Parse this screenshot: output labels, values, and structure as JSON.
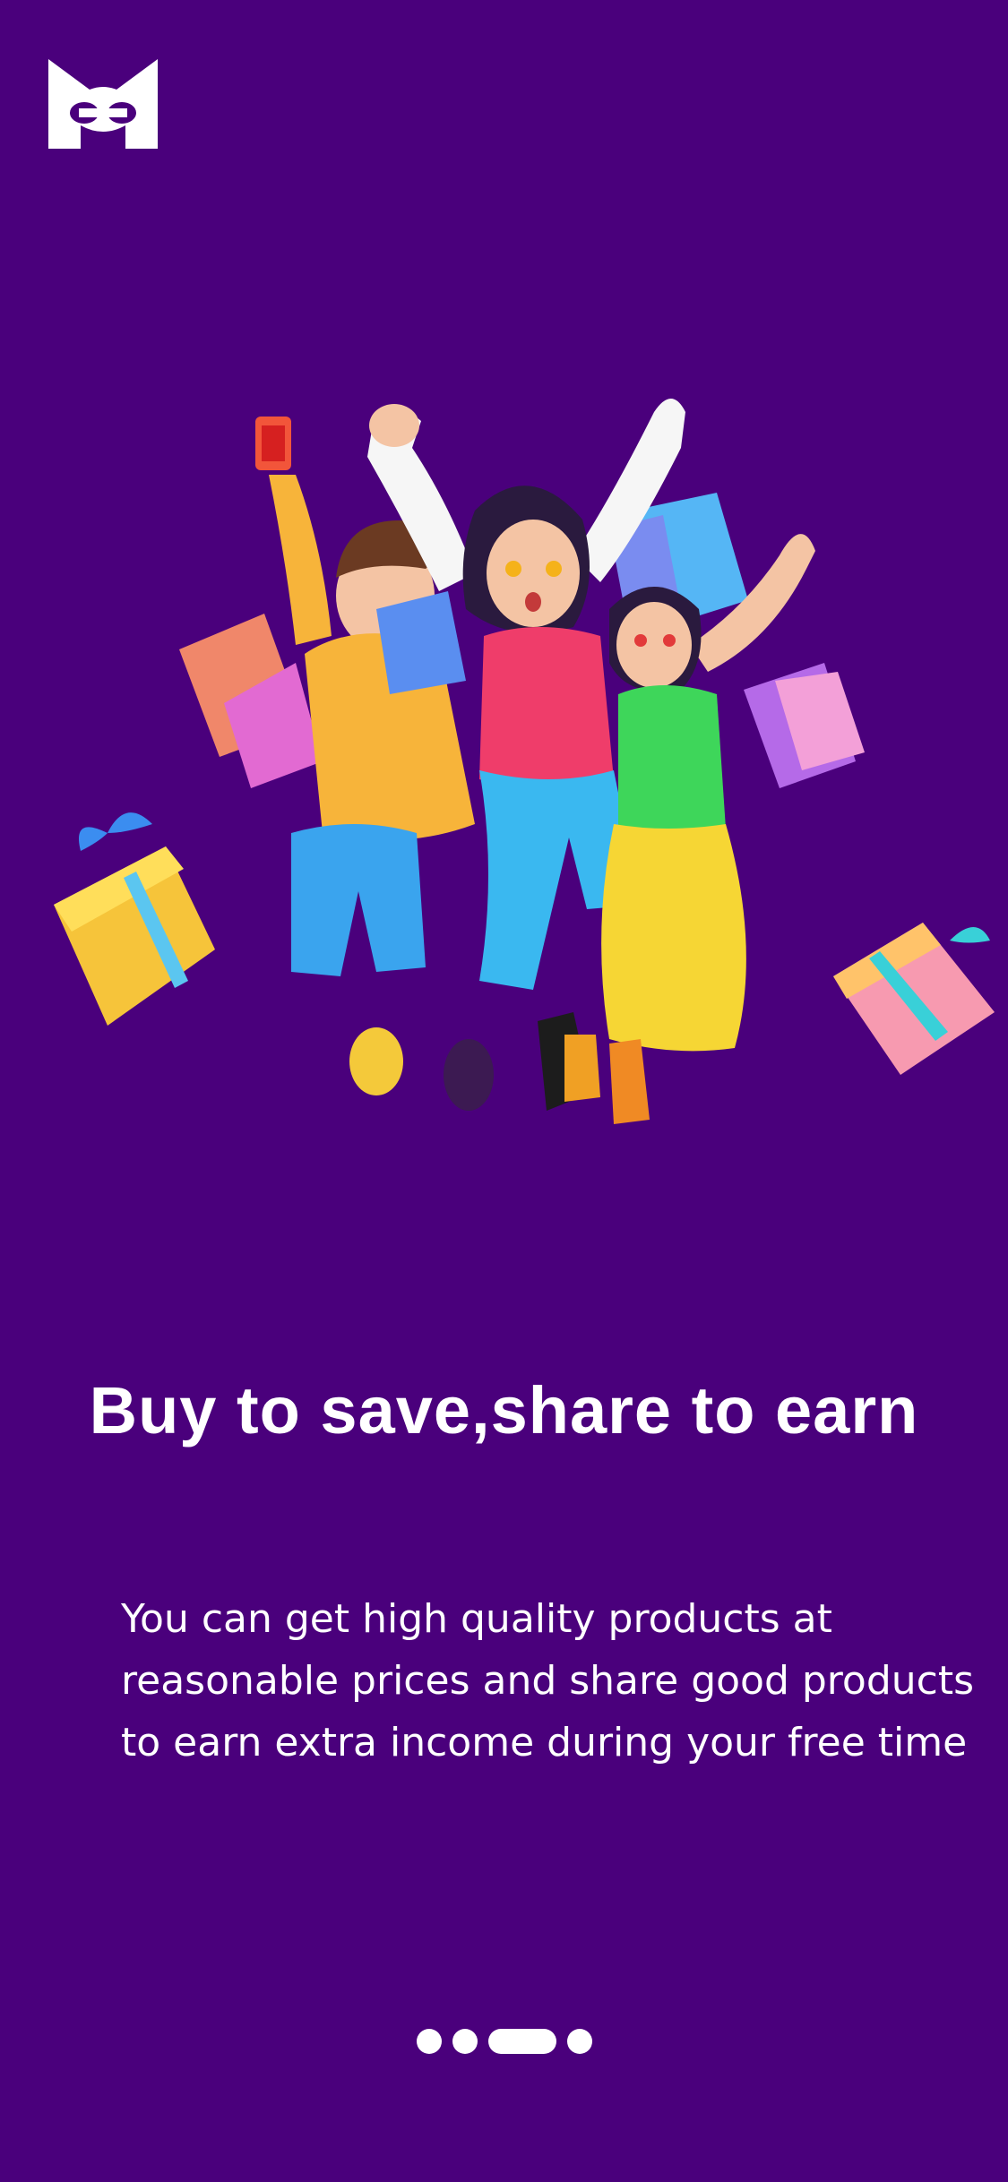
{
  "brand": {
    "logo_icon": "mask-logo-icon"
  },
  "hero": {
    "illustration": "people-celebrating-shopping-illustration"
  },
  "onboarding": {
    "headline": "Buy to save,share to earn",
    "description": "You can get high quality products at reasonable prices and share good products to earn extra income during your free time"
  },
  "pagination": {
    "total_pages": 4,
    "current_page": 3
  },
  "colors": {
    "background": "#4a007c",
    "text": "#ffffff"
  }
}
